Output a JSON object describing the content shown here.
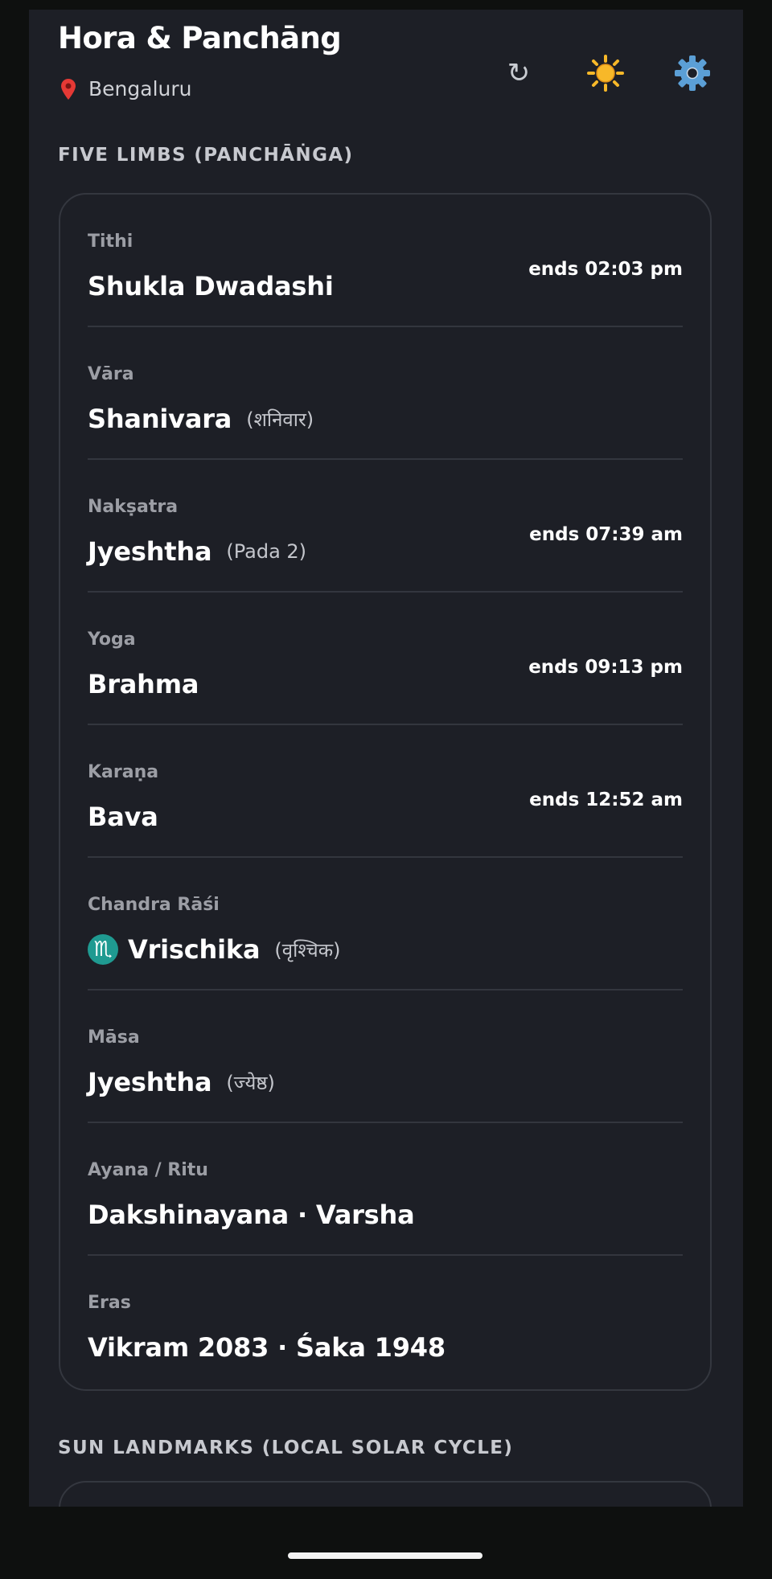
{
  "header": {
    "title": "Hora & Panchāng",
    "location": "Bengaluru",
    "icons": {
      "location": "map-pin-icon",
      "refresh": "refresh-icon",
      "theme": "sun-icon",
      "settings": "gear-icon"
    },
    "refresh_glyph": "↻"
  },
  "sections": {
    "five_limbs_title": "FIVE LIMBS (PANCHĀṄGA)",
    "sun_landmarks_title": "SUN LANDMARKS (LOCAL SOLAR CYCLE)"
  },
  "limbs": [
    {
      "label": "Tithi",
      "value": "Shukla Dwadashi",
      "sub": "",
      "end": "ends 02:03 pm"
    },
    {
      "label": "Vāra",
      "value": "Shanivara",
      "sub": "(शनिवार)",
      "end": ""
    },
    {
      "label": "Nakṣatra",
      "value": "Jyeshtha",
      "sub": "(Pada 2)",
      "end": "ends 07:39 am"
    },
    {
      "label": "Yoga",
      "value": "Brahma",
      "sub": "",
      "end": "ends 09:13 pm"
    },
    {
      "label": "Karaṇa",
      "value": "Bava",
      "sub": "",
      "end": "ends 12:52 am"
    },
    {
      "label": "Chandra Rāśi",
      "value": "Vrischika",
      "sub": "(वृश्चिक)",
      "end": "",
      "icon": "♏",
      "icon_name": "scorpio-icon"
    },
    {
      "label": "Māsa",
      "value": "Jyeshtha",
      "sub": "(ज्येष्ठ)",
      "end": ""
    },
    {
      "label": "Ayana / Ritu",
      "value": "Dakshinayana · Varsha",
      "sub": "",
      "end": ""
    },
    {
      "label": "Eras",
      "value": "Vikram 2083 · Śaka 1948",
      "sub": "",
      "end": ""
    }
  ],
  "colors": {
    "background": "#0e100f",
    "surface": "#1d1f26",
    "border": "#34373f",
    "accent_zodiac": "#1f9a91",
    "sun": "#f7b829",
    "gear": "#5b9fd6"
  }
}
